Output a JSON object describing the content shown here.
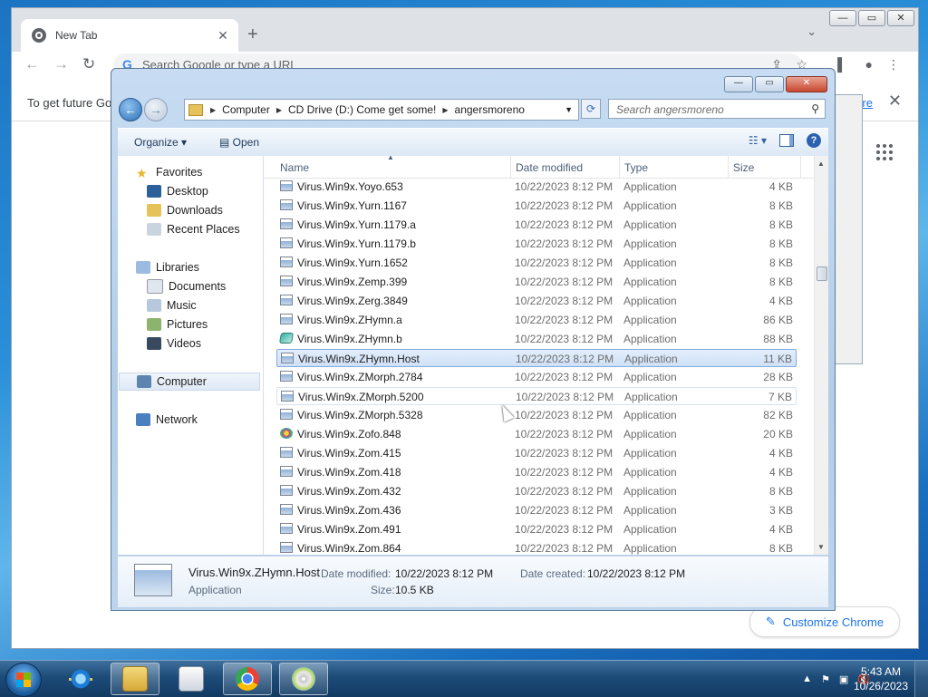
{
  "chrome": {
    "tab_title": "New Tab",
    "omnibox_placeholder": "Search Google or type a URL",
    "infobar_text": "To get future Go",
    "infobar_link": "ore",
    "customize_label": "Customize Chrome"
  },
  "dialog": {
    "breadcrumb": [
      "Computer",
      "CD Drive (D:) Come get some!",
      "angersmoreno"
    ],
    "search_placeholder": "Search angersmoreno",
    "commands": {
      "organize": "Organize",
      "open": "Open"
    },
    "nav": {
      "favorites": "Favorites",
      "desktop": "Desktop",
      "downloads": "Downloads",
      "recent": "Recent Places",
      "libraries": "Libraries",
      "documents": "Documents",
      "music": "Music",
      "pictures": "Pictures",
      "videos": "Videos",
      "computer": "Computer",
      "network": "Network"
    },
    "columns": {
      "name": "Name",
      "date": "Date modified",
      "type": "Type",
      "size": "Size"
    },
    "files": [
      {
        "name": "Virus.Win9x.Yoyo.653",
        "date": "10/22/2023 8:12 PM",
        "type": "Application",
        "size": "4 KB"
      },
      {
        "name": "Virus.Win9x.Yurn.1167",
        "date": "10/22/2023 8:12 PM",
        "type": "Application",
        "size": "8 KB"
      },
      {
        "name": "Virus.Win9x.Yurn.1179.a",
        "date": "10/22/2023 8:12 PM",
        "type": "Application",
        "size": "8 KB"
      },
      {
        "name": "Virus.Win9x.Yurn.1179.b",
        "date": "10/22/2023 8:12 PM",
        "type": "Application",
        "size": "8 KB"
      },
      {
        "name": "Virus.Win9x.Yurn.1652",
        "date": "10/22/2023 8:12 PM",
        "type": "Application",
        "size": "8 KB"
      },
      {
        "name": "Virus.Win9x.Zemp.399",
        "date": "10/22/2023 8:12 PM",
        "type": "Application",
        "size": "8 KB"
      },
      {
        "name": "Virus.Win9x.Zerg.3849",
        "date": "10/22/2023 8:12 PM",
        "type": "Application",
        "size": "4 KB"
      },
      {
        "name": "Virus.Win9x.ZHymn.a",
        "date": "10/22/2023 8:12 PM",
        "type": "Application",
        "size": "86 KB"
      },
      {
        "name": "Virus.Win9x.ZHymn.b",
        "date": "10/22/2023 8:12 PM",
        "type": "Application",
        "size": "88 KB"
      },
      {
        "name": "Virus.Win9x.ZHymn.Host",
        "date": "10/22/2023 8:12 PM",
        "type": "Application",
        "size": "11 KB"
      },
      {
        "name": "Virus.Win9x.ZMorph.2784",
        "date": "10/22/2023 8:12 PM",
        "type": "Application",
        "size": "28 KB"
      },
      {
        "name": "Virus.Win9x.ZMorph.5200",
        "date": "10/22/2023 8:12 PM",
        "type": "Application",
        "size": "7 KB"
      },
      {
        "name": "Virus.Win9x.ZMorph.5328",
        "date": "10/22/2023 8:12 PM",
        "type": "Application",
        "size": "82 KB"
      },
      {
        "name": "Virus.Win9x.Zofo.848",
        "date": "10/22/2023 8:12 PM",
        "type": "Application",
        "size": "20 KB"
      },
      {
        "name": "Virus.Win9x.Zom.415",
        "date": "10/22/2023 8:12 PM",
        "type": "Application",
        "size": "4 KB"
      },
      {
        "name": "Virus.Win9x.Zom.418",
        "date": "10/22/2023 8:12 PM",
        "type": "Application",
        "size": "4 KB"
      },
      {
        "name": "Virus.Win9x.Zom.432",
        "date": "10/22/2023 8:12 PM",
        "type": "Application",
        "size": "8 KB"
      },
      {
        "name": "Virus.Win9x.Zom.436",
        "date": "10/22/2023 8:12 PM",
        "type": "Application",
        "size": "3 KB"
      },
      {
        "name": "Virus.Win9x.Zom.491",
        "date": "10/22/2023 8:12 PM",
        "type": "Application",
        "size": "4 KB"
      },
      {
        "name": "Virus.Win9x.Zom.864",
        "date": "10/22/2023 8:12 PM",
        "type": "Application",
        "size": "8 KB"
      }
    ],
    "selected_index": 9,
    "details": {
      "name": "Virus.Win9x.ZHymn.Host",
      "type": "Application",
      "date_modified_label": "Date modified:",
      "date_modified": "10/22/2023 8:12 PM",
      "date_created_label": "Date created:",
      "date_created": "10/22/2023 8:12 PM",
      "size_label": "Size:",
      "size": "10.5 KB"
    }
  },
  "taskbar": {
    "time": "5:43 AM",
    "date": "10/26/2023"
  }
}
